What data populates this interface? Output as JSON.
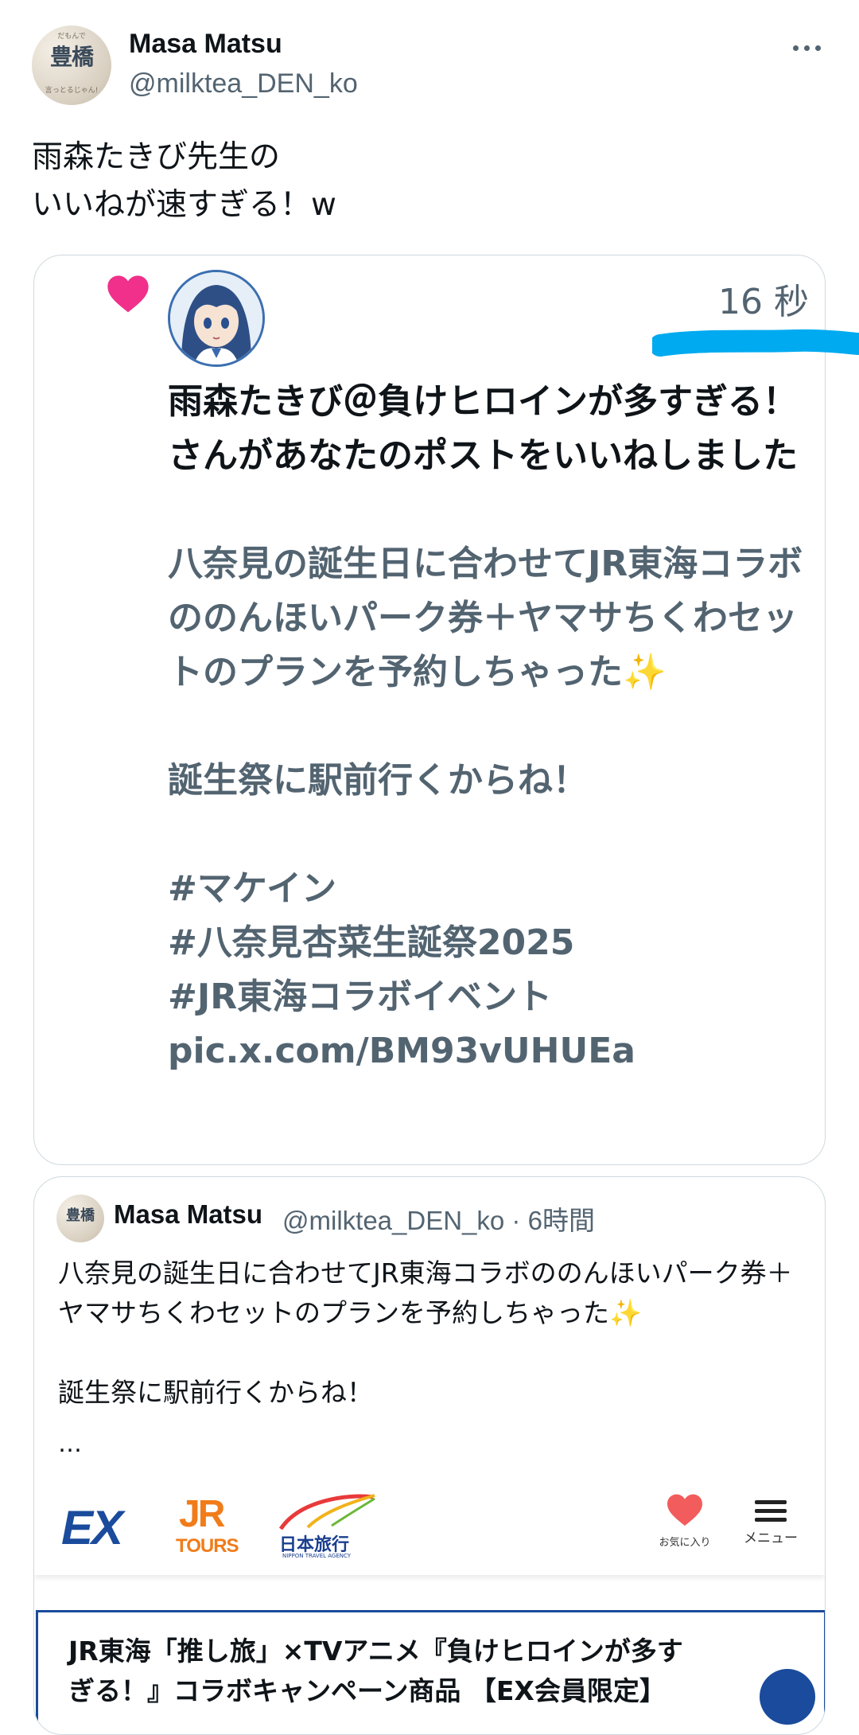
{
  "post": {
    "display_name": "Masa Matsu",
    "handle": "@milktea_DEN_ko",
    "avatar_text": "豊橋",
    "avatar_small_top": "だもんで",
    "avatar_small_bottom": "言っとるじゃん!",
    "text": "雨森たきび先生の\nいいねが速すぎる！w"
  },
  "screenshot_card": {
    "time": "16 秒",
    "title": "雨森たきび＠負けヒロインが多すぎる！さんがあなたのポストをいいねしました",
    "body": "八奈見の誕生日に合わせてJR東海コラボののんほいパーク券＋ヤマサちくわセットのプランを予約しちゃった✨\n\n誕生祭に駅前行くからね！\n\n#マケイン\n#八奈見杏菜生誕祭2025\n#JR東海コラボイベント\npic.x.com/BM93vUHUEa",
    "heart_color": "#f0308a",
    "highlight_color": "#00aaf0"
  },
  "quoted": {
    "avatar_text": "豊橋",
    "display_name": "Masa Matsu",
    "meta": "@milktea_DEN_ko · 6時間",
    "text": "八奈見の誕生日に合わせてJR東海コラボののんほいパーク券＋ヤマサちくわセットのプランを予約しちゃった✨\n\n誕生祭に駅前行くからね！",
    "ellipsis": "…"
  },
  "banner": {
    "ex": "EX",
    "jr": "JR",
    "tours": "TOURS",
    "nta": "日本旅行",
    "nta_sub": "NIPPON TRAVEL AGENCY",
    "favorite_label": "お気に入り",
    "menu_label": "メニュー"
  },
  "article": {
    "title": "JR東海「推し旅」×TVアニメ『負けヒロインが多す\nぎる！』コラボキャンペーン商品 【EX会員限定】"
  }
}
